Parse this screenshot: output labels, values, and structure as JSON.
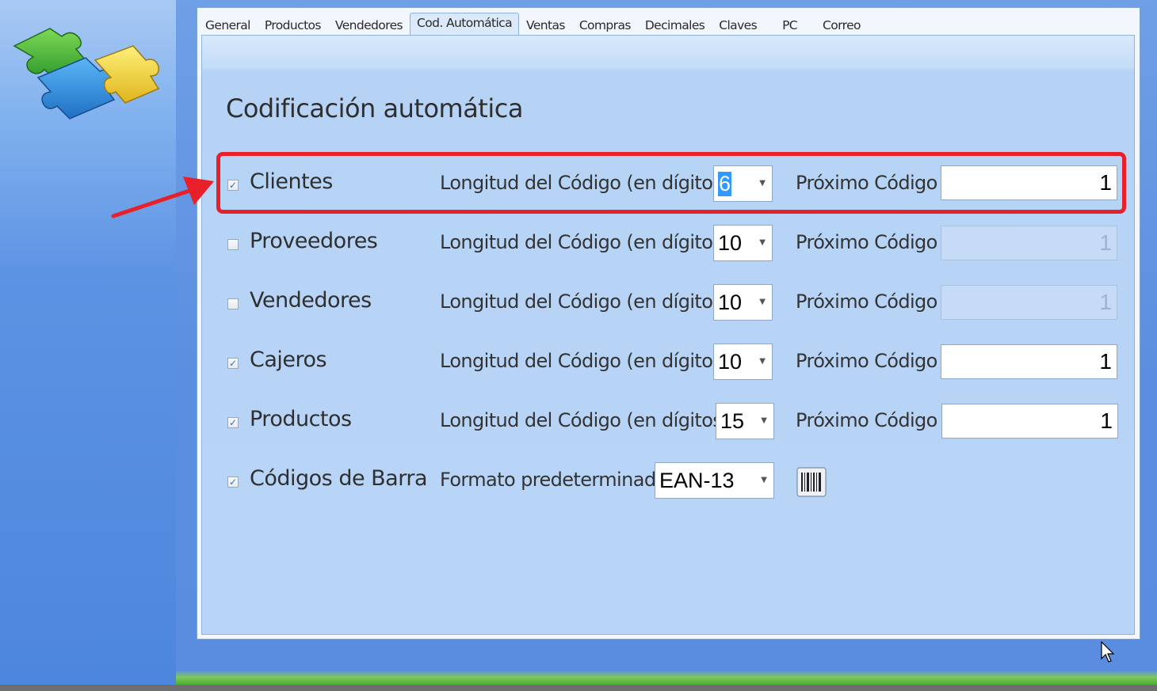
{
  "tabs": [
    {
      "label": "General"
    },
    {
      "label": "Productos"
    },
    {
      "label": "Vendedores"
    },
    {
      "label": "Cod. Automática",
      "active": true
    },
    {
      "label": "Ventas"
    },
    {
      "label": "Compras"
    },
    {
      "label": "Decimales"
    },
    {
      "label": "Claves"
    },
    {
      "label": "PC"
    },
    {
      "label": "Correo"
    }
  ],
  "section_title": "Codificación automática",
  "length_label": "Longitud del Código (en dígitos)",
  "next_label": "Próximo Código",
  "rows": [
    {
      "label": "Clientes",
      "checked": true,
      "length": "6",
      "next_code": "1",
      "next_enabled": true
    },
    {
      "label": "Proveedores",
      "checked": false,
      "length": "10",
      "next_code": "1",
      "next_enabled": false
    },
    {
      "label": "Vendedores",
      "checked": false,
      "length": "10",
      "next_code": "1",
      "next_enabled": false
    },
    {
      "label": "Cajeros",
      "checked": true,
      "length": "10",
      "next_code": "1",
      "next_enabled": true
    },
    {
      "label": "Productos",
      "checked": true,
      "length": "15",
      "next_code": "1",
      "next_enabled": true
    }
  ],
  "barcode": {
    "label": "Códigos de Barra",
    "checked": true,
    "format_label": "Formato predeterminado",
    "format_value": "EAN-13",
    "icon": "barcode-icon"
  },
  "colors": {
    "highlight": "#e8202a",
    "selection": "#3399ff"
  }
}
